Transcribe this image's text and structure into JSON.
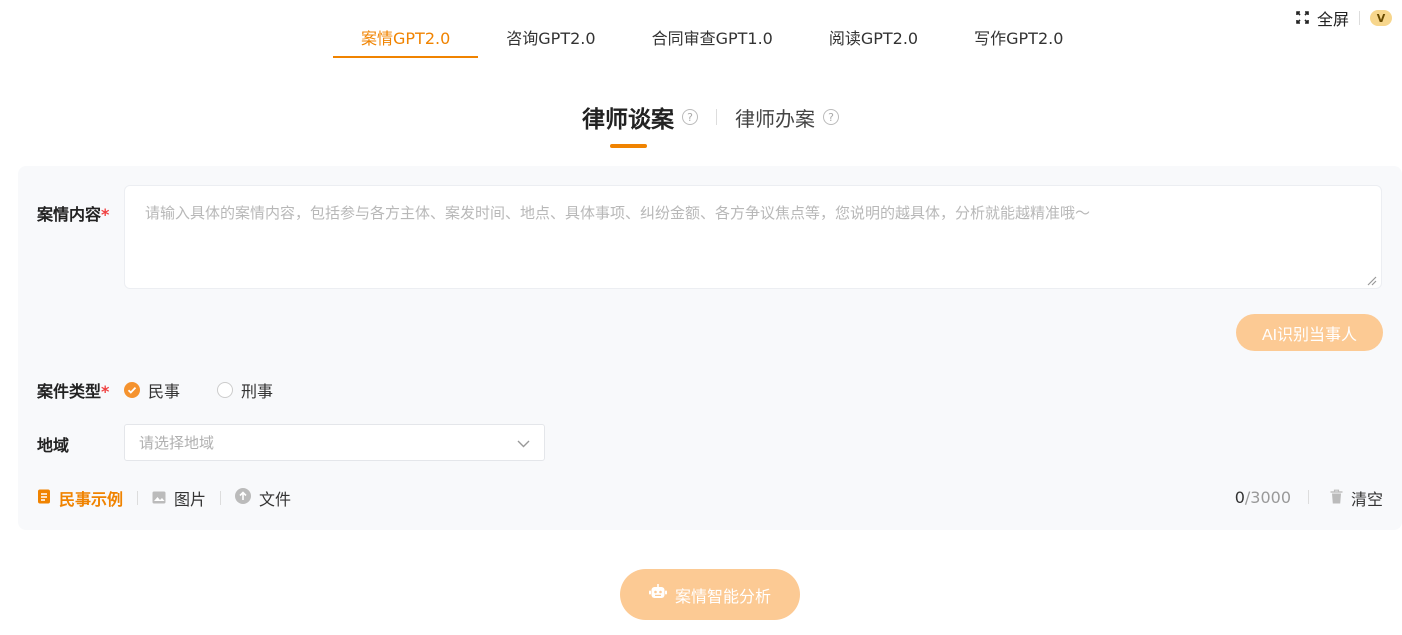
{
  "topbar": {
    "fullscreen_label": "全屏",
    "badge_label": "V"
  },
  "tabs": [
    {
      "label": "案情GPT2.0",
      "active": true
    },
    {
      "label": "咨询GPT2.0"
    },
    {
      "label": "合同审查GPT1.0"
    },
    {
      "label": "阅读GPT2.0"
    },
    {
      "label": "写作GPT2.0"
    }
  ],
  "modes": [
    {
      "label": "律师谈案",
      "active": true
    },
    {
      "label": "律师办案"
    }
  ],
  "form": {
    "content_label": "案情内容",
    "required_mark": "*",
    "content_placeholder": "请输入具体的案情内容，包括参与各方主体、案发时间、地点、具体事项、纠纷金额、各方争议焦点等，您说明的越具体，分析就能越精准哦～",
    "ai_button": "AI识别当事人",
    "type_label": "案件类型",
    "type_options": [
      {
        "label": "民事",
        "selected": true
      },
      {
        "label": "刑事",
        "selected": false
      }
    ],
    "region_label": "地域",
    "region_placeholder": "请选择地域"
  },
  "tools": {
    "example_label": "民事示例",
    "image_label": "图片",
    "file_label": "文件",
    "count_current": "0",
    "count_max": "/3000",
    "clear_label": "清空"
  },
  "analyze_button": "案情智能分析",
  "colors": {
    "accent": "#f08300",
    "button_disabled": "#fcca94",
    "panel_bg": "#f8f9fb"
  }
}
